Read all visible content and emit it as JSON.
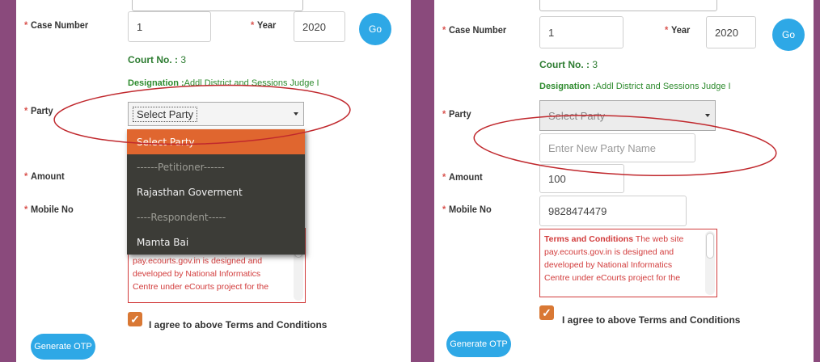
{
  "left": {
    "case_number_label": "Case Number",
    "case_number_value": "1",
    "year_label": "Year",
    "year_value": "2020",
    "go_label": "Go",
    "court_label": "Court No. :",
    "court_value": "3",
    "designation_label": "Designation :",
    "designation_value": "Addl District and Sessions Judge I",
    "party_label": "Party",
    "party_selected": "Select Party",
    "amount_label": "Amount",
    "mobile_label": "Mobile No",
    "dropdown_options": [
      "Select Party",
      "------Petitioner------",
      "Rajasthan Goverment",
      "----Respondent-----",
      "Mamta Bai"
    ],
    "terms_text": "pay.ecourts.gov.in is designed and developed by National Informatics Centre under eCourts project for the",
    "agree_label": "I agree to above Terms and Conditions",
    "otp_label": "Generate OTP"
  },
  "right": {
    "case_number_label": "Case Number",
    "case_number_value": "1",
    "year_label": "Year",
    "year_value": "2020",
    "go_label": "Go",
    "court_label": "Court No. :",
    "court_value": "3",
    "designation_label": "Designation :",
    "designation_value": "Addl District and Sessions Judge I",
    "party_label": "Party",
    "party_selected": "Select Party",
    "new_party_placeholder": "Enter New Party Name",
    "amount_label": "Amount",
    "amount_value": "100",
    "mobile_label": "Mobile No",
    "mobile_value": "9828474479",
    "terms_title": "Terms and Conditions",
    "terms_text": "The web site pay.ecourts.gov.in is designed and developed by National Informatics Centre under eCourts project for the",
    "agree_label": "I agree to above Terms and Conditions",
    "otp_label": "Generate OTP"
  },
  "colors": {
    "background": "#8a4a7c",
    "go_button": "#2ea8e6",
    "selected_option": "#e0662f",
    "annotation_ellipse": "#c0282d",
    "terms_border": "#d23c3c"
  }
}
